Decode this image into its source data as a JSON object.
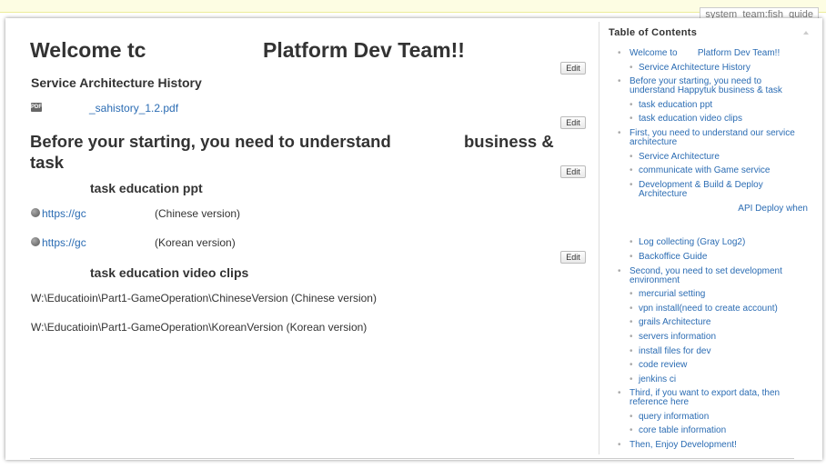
{
  "page_id": "system_team:fish_guide",
  "edit_label": "Edit",
  "content": {
    "title_part1": "Welcome tc",
    "title_part2": "Platform Dev Team!!",
    "history_heading": "Service Architecture History",
    "history_file": "_sahistory_1.2.pdf",
    "before_heading_line1": "Before your starting, you need to understand",
    "before_heading_word": "business &",
    "before_heading_line2": "task",
    "ppt_heading": "task education ppt",
    "ppt_links": [
      {
        "url": "https://gc",
        "version": "(Chinese version)"
      },
      {
        "url": "https://gc",
        "version": "(Korean version)"
      }
    ],
    "video_heading": "task education video clips",
    "video_paths": [
      "W:\\Educatioin\\Part1-GameOperation\\ChineseVersion (Chinese version)",
      "W:\\Educatioin\\Part1-GameOperation\\KoreanVersion (Korean version)"
    ]
  },
  "toc": {
    "title": "Table of Contents",
    "items": [
      {
        "text": "Welcome to        Platform Dev Team!!",
        "level": 1
      },
      {
        "text": "Service Architecture History",
        "level": 2
      },
      {
        "text": "Before your starting, you need to\nunderstand Happytuk business & task",
        "level": 1
      },
      {
        "text": "task education ppt",
        "level": 2
      },
      {
        "text": "task education video clips",
        "level": 2
      },
      {
        "text": "First, you need to understand our service\narchitecture",
        "level": 1
      },
      {
        "text": "Service Architecture",
        "level": 2
      },
      {
        "text": "communicate with Game service",
        "level": 2
      },
      {
        "text": "Development & Build & Deploy\nArchitecture",
        "level": 2
      },
      {
        "text": "API Deploy when",
        "level": 3
      },
      {
        "text": "Log collecting (Gray Log2)",
        "level": 2
      },
      {
        "text": "Backoffice Guide",
        "level": 2
      },
      {
        "text": "Second, you need to set development\nenvironment",
        "level": 1
      },
      {
        "text": "mercurial setting",
        "level": 2
      },
      {
        "text": "vpn install(need to create account)",
        "level": 2
      },
      {
        "text": "grails Architecture",
        "level": 2
      },
      {
        "text": "servers information",
        "level": 2
      },
      {
        "text": "install files for dev",
        "level": 2
      },
      {
        "text": "code review",
        "level": 2
      },
      {
        "text": "jenkins ci",
        "level": 2
      },
      {
        "text": "Third, if you want to export data, then\nreference here",
        "level": 1
      },
      {
        "text": "query information",
        "level": 2
      },
      {
        "text": "core table information",
        "level": 2
      },
      {
        "text": "Then, Enjoy Development!",
        "level": 1
      }
    ]
  }
}
